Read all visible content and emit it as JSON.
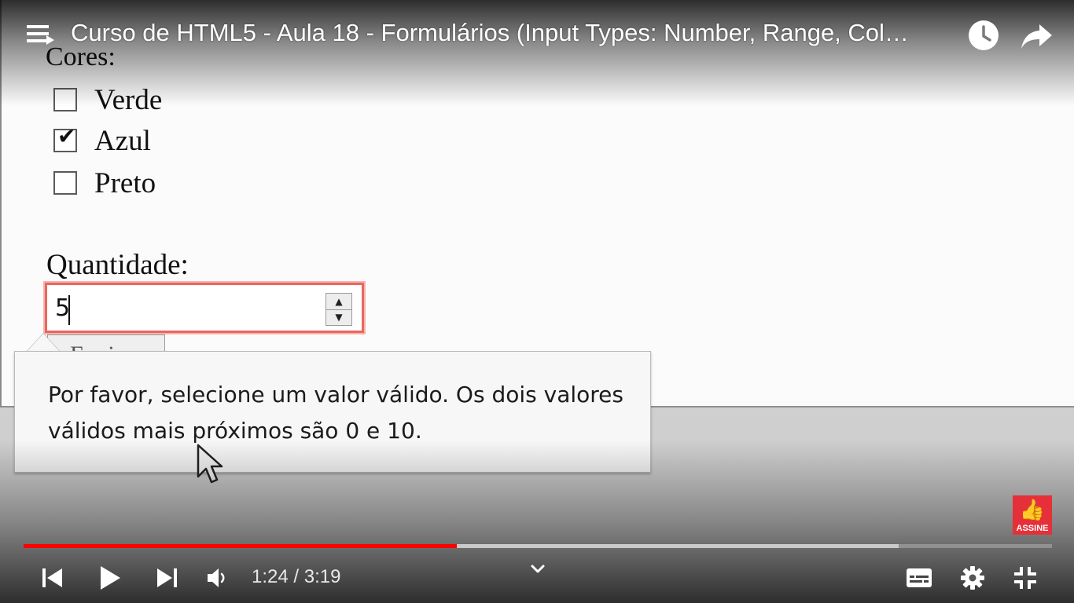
{
  "video": {
    "title": "Curso de HTML5 - Aula 18 - Formulários (Input Types: Number, Range, Col…",
    "time": {
      "current": "1:24",
      "duration": "3:19",
      "display": "1:24 / 3:19"
    },
    "progress": {
      "played_fraction": 0.421,
      "loaded_fraction": 0.851
    },
    "subscribe_badge": "ASSINE",
    "accent_color": "#ff0000"
  },
  "form": {
    "cores_label": "Cores:",
    "checkboxes": [
      {
        "label": "Verde",
        "checked": false
      },
      {
        "label": "Azul",
        "checked": true
      },
      {
        "label": "Preto",
        "checked": false
      }
    ],
    "quantidade_label": "Quantidade:",
    "quantidade_value": "5",
    "submit_label": "Enviar",
    "invalid_border_color": "#e8675f"
  },
  "tooltip": {
    "message": "Por favor, selecione um valor válido. Os dois valores válidos mais próximos são 0 e 10."
  },
  "icons": {
    "menu": "hamburger-menu-icon",
    "watch_later": "clock-icon",
    "share": "share-arrow-icon",
    "previous": "skip-previous-icon",
    "play": "play-icon",
    "next": "skip-next-icon",
    "volume": "volume-icon",
    "more": "chevron-down-icon",
    "subtitles": "subtitles-icon",
    "settings": "gear-icon",
    "exit_fullscreen": "exit-fullscreen-icon"
  }
}
